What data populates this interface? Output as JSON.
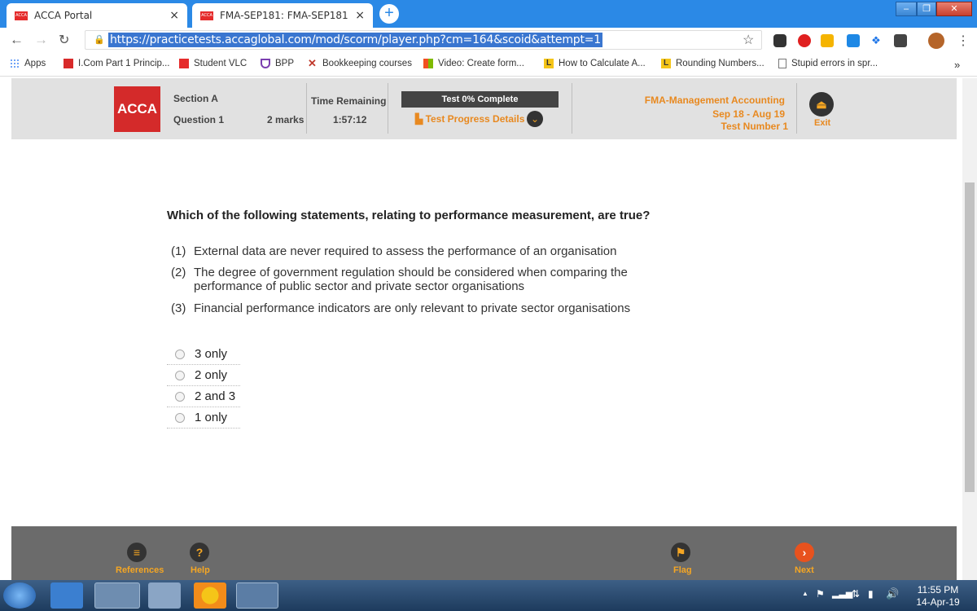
{
  "browser": {
    "tabs": [
      {
        "label": "ACCA Portal",
        "active": false
      },
      {
        "label": "FMA-SEP181: FMA-SEP181",
        "active": true
      }
    ],
    "url": "https://practicetests.accaglobal.com/mod/scorm/player.php?cm=164&scoid&attempt=1",
    "bookmarks": [
      {
        "label": "Apps",
        "icon": "apps-grid-icon"
      },
      {
        "label": "I.Com Part 1 Princip...",
        "icon": "bookmark-icon"
      },
      {
        "label": "Student VLC",
        "icon": "acca-icon"
      },
      {
        "label": "BPP",
        "icon": "shield-icon"
      },
      {
        "label": "Bookkeeping courses",
        "icon": "x-icon"
      },
      {
        "label": "Video: Create form...",
        "icon": "windows-icon"
      },
      {
        "label": "How to Calculate A...",
        "icon": "l-icon"
      },
      {
        "label": "Rounding Numbers...",
        "icon": "l-icon"
      },
      {
        "label": "Stupid errors in spr...",
        "icon": "page-icon"
      }
    ],
    "bookmarks_more": "»"
  },
  "header": {
    "logo": "ACCA",
    "section": "Section A",
    "question_label": "Question 1",
    "marks": "2 marks",
    "time_label": "Time Remaining",
    "time_value": "1:57:12",
    "progress_label": "Test 0% Complete",
    "progress_percent": 0,
    "progress_details": "Test Progress Details",
    "exam_title": "FMA-Management Accounting",
    "exam_dates": "Sep 18 - Aug 19",
    "test_number": "Test Number 1",
    "exit_label": "Exit"
  },
  "question": {
    "text": "Which of the following statements, relating to performance measurement, are true?",
    "statements": [
      {
        "num": "(1)",
        "text": "External data are never required to assess the performance of an organisation"
      },
      {
        "num": "(2)",
        "text": "The degree of government regulation should be considered when comparing the performance of public sector and private sector organisations"
      },
      {
        "num": "(3)",
        "text": "Financial performance indicators are only relevant to private sector organisations"
      }
    ],
    "options": [
      "3 only",
      "2 only",
      "2 and 3",
      "1 only"
    ]
  },
  "footer": {
    "references": "References",
    "help": "Help",
    "flag": "Flag",
    "next": "Next"
  },
  "taskbar": {
    "time": "11:55 PM",
    "date": "14-Apr-19"
  },
  "colors": {
    "acca_red": "#d42a2a",
    "accent_orange": "#e88920",
    "chrome_blue": "#2b89e6"
  }
}
